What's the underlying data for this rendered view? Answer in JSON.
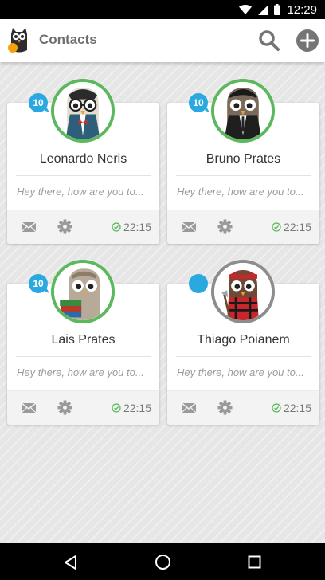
{
  "status_bar": {
    "time": "12:29"
  },
  "app_bar": {
    "title": "Contacts"
  },
  "colors": {
    "accent_blue": "#2aa9e0",
    "online_green": "#5cb85c",
    "offline_gray": "#8d8d8d"
  },
  "contacts": [
    {
      "name": "Leonardo Neris",
      "message": "Hey there, how are you to...",
      "time": "22:15",
      "badge": "10",
      "status": "online",
      "avatar_icon": "owl-glasses-bowtie-icon"
    },
    {
      "name": "Bruno Prates",
      "message": "Hey there, how are you to...",
      "time": "22:15",
      "badge": "10",
      "status": "online",
      "avatar_icon": "owl-suit-icon"
    },
    {
      "name": "Lais Prates",
      "message": "Hey there, how are you to...",
      "time": "22:15",
      "badge": "10",
      "status": "online",
      "avatar_icon": "owl-books-icon"
    },
    {
      "name": "Thiago Poianem",
      "message": "Hey there, how are you to...",
      "time": "22:15",
      "badge": "",
      "status": "offline",
      "avatar_icon": "owl-lumberjack-icon"
    }
  ]
}
